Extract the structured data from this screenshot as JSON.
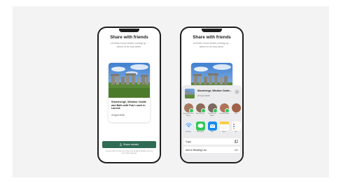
{
  "share_screen": {
    "title": "Share with friends",
    "subtitle": "Let them know what's coming up – where to be and when.",
    "event": {
      "title": "Stonehenge, Windsor Castle and Bath with Pub Lunch in Lacock",
      "date": "20 April 2026"
    },
    "share_button_label": "Share details",
    "footnote": "Anyone with the link can view your booking details and you can make changes"
  },
  "share_sheet": {
    "event_title": "Stonehenge, Windsor Castle...",
    "event_date": "20 April 2026",
    "close_label": "×",
    "contacts": [
      {
        "name": "George Forrest-Wong",
        "color": "#a8785e",
        "badge": true
      },
      {
        "name": "Alex Laurey",
        "color": "#8c6b55",
        "badge": true
      },
      {
        "name": "Soraya and Aidan",
        "color": "#7c6a62",
        "badge": true
      },
      {
        "name": "Luciana Mateo",
        "color": "#b07256",
        "badge": true
      },
      {
        "name": "Hai",
        "color": "#a06045",
        "badge": false
      }
    ],
    "apps": [
      {
        "name": "AirDrop",
        "icon": "airdrop-icon",
        "color": "#e9eef6"
      },
      {
        "name": "Messages",
        "icon": "messages-icon",
        "color": "#34c759"
      },
      {
        "name": "Mail",
        "icon": "mail-icon",
        "color": "#1a8cf0"
      },
      {
        "name": "Notes",
        "icon": "notes-icon",
        "color": "#f6cf46"
      },
      {
        "name": "Re",
        "icon": "reminders-icon",
        "color": "#ffffff"
      }
    ],
    "actions": [
      {
        "label": "Copy",
        "icon": "copy-icon"
      },
      {
        "label": "Add to Reading List",
        "icon": "glasses-icon"
      }
    ]
  }
}
